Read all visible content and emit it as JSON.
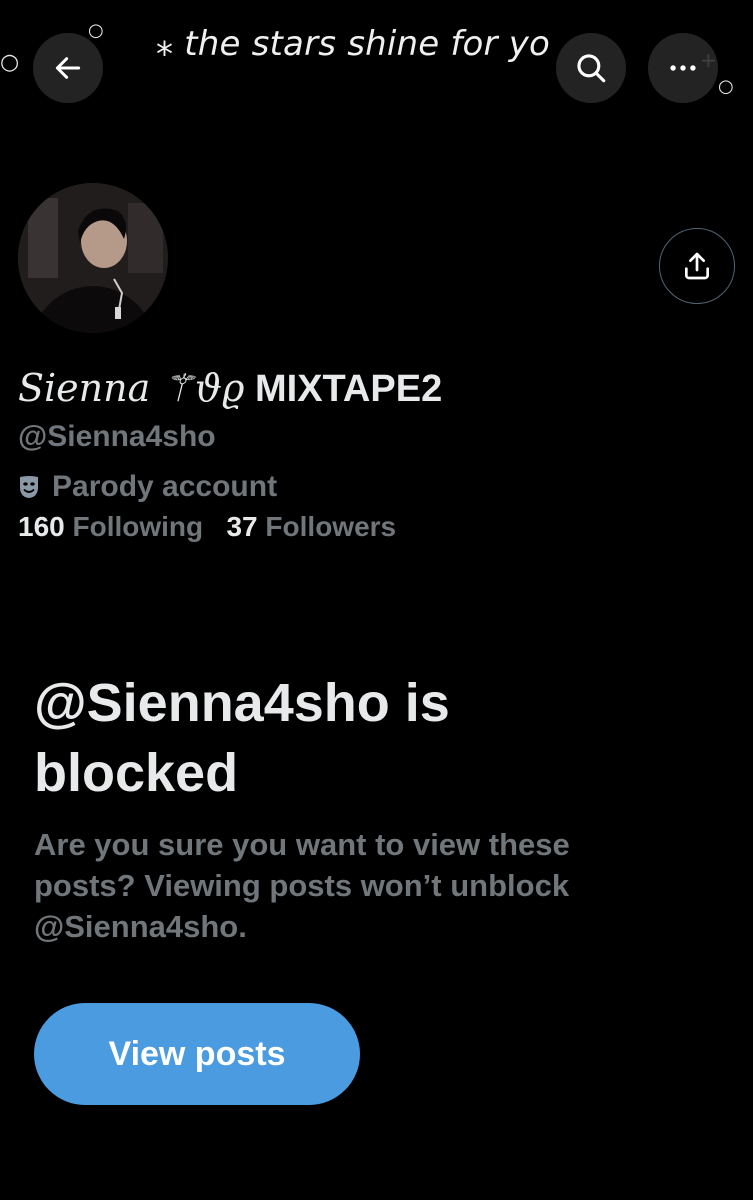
{
  "banner": {
    "text": "⁎ the stars shine for yo"
  },
  "profile": {
    "display_name_script": "Sienna",
    "display_name_symbols": "⚚ϑϱ",
    "display_name_tail": "MIXTAPE2",
    "handle": "@Sienna4sho",
    "label": "Parody account",
    "following_count": "160",
    "following_label": "Following",
    "followers_count": "37",
    "followers_label": "Followers"
  },
  "blocked": {
    "title": "@Sienna4sho is blocked",
    "description": "Are you sure you want to view these posts? Viewing posts won’t unblock @Sienna4sho.",
    "button_label": "View posts"
  },
  "icons": {
    "back": "arrow-left-icon",
    "search": "search-icon",
    "more": "more-horizontal-icon",
    "share": "share-icon",
    "parody": "theater-mask-icon"
  },
  "colors": {
    "background": "#000000",
    "primary_text": "#e7e9ea",
    "secondary_text": "#71767b",
    "button": "#4a9be0"
  }
}
